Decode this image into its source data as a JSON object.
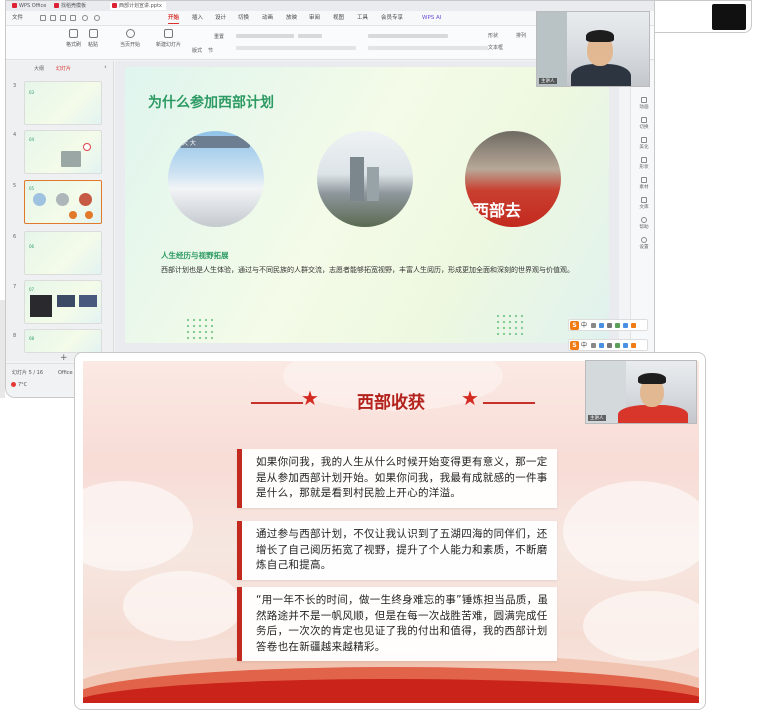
{
  "editor": {
    "window_tabs": [
      "WPS Office",
      "找稻壳模板",
      "西部计划宣讲.pptx"
    ],
    "menu": [
      "文件",
      "开始",
      "插入",
      "设计",
      "切换",
      "动画",
      "放映",
      "审阅",
      "视图",
      "工具",
      "会员专享",
      "WPS AI"
    ],
    "active_menu": "开始",
    "ribbon": {
      "format_painter": "格式刷",
      "paste": "粘贴",
      "play_from_current": "当页开始",
      "new_slide": "新建幻灯片",
      "layout": "版式",
      "section": "节",
      "reset": "重置",
      "shape": "形状",
      "arrange": "排列",
      "textbox": "文本框"
    },
    "panel_tabs": [
      "大纲",
      "幻灯片"
    ],
    "active_panel_tab": "幻灯片",
    "thumb_numbers": [
      "3",
      "4",
      "5",
      "6",
      "7",
      "8"
    ],
    "thumb_texts": [
      "03",
      "04",
      "05",
      "06",
      "07",
      "08"
    ],
    "selected_thumb": "5",
    "add_slide_symbol": "+",
    "slide": {
      "title": "为什么参加西部计划",
      "photo1_caption": "大 大",
      "photo3_caption": "西部去",
      "subheading": "人生经历与视野拓展",
      "body": "西部计划也是人生体验，通过与不同民族的人群交流，志愿者能够拓宽视野，丰富人生阅历，形成更加全面和深刻的世界观与价值观。"
    },
    "right_rail": [
      "动画",
      "切换",
      "美化",
      "形状",
      "素材",
      "文库",
      "帮助",
      "设置"
    ],
    "ime_label": "中",
    "status": {
      "page": "幻灯片 5 / 16",
      "theme": "Office 主题",
      "temperature": "7°C"
    },
    "webcam_tag": "主讲人"
  },
  "presentation": {
    "title": "西部收获",
    "cards": [
      "如果你问我，我的人生从什么时候开始变得更有意义，那一定是从参加西部计划开始。如果你问我，我最有成就感的一件事是什么，那就是看到村民脸上开心的洋溢。",
      "通过参与西部计划，不仅让我认识到了五湖四海的同伴们，还增长了自己阅历拓宽了视野，提升了个人能力和素质，不断磨炼自己和提高。",
      "“用一年不长的时间，做一生终身难忘的事”锤炼担当品质，虽然路途并不是一帆风顺，但是在每一次战胜苦难，圆满完成任务后，一次次的肯定也见证了我的付出和值得，我的西部计划答卷也在新疆越来越精彩。"
    ],
    "webcam_tag": "主讲人"
  },
  "colors": {
    "accent_red": "#d8342c",
    "slide_green": "#2c9a62",
    "card_bar": "#c22a20"
  }
}
